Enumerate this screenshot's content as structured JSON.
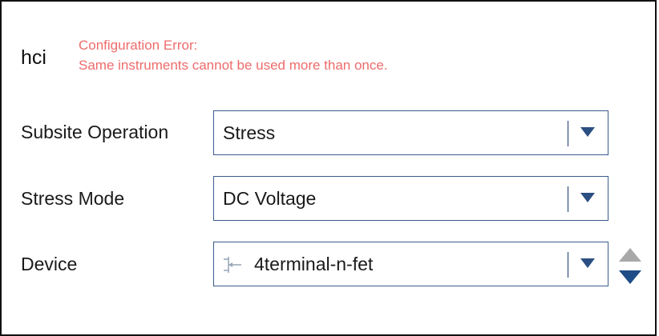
{
  "header": {
    "title": "hci",
    "error_line1": "Configuration Error:",
    "error_line2": "Same instruments cannot be used more than once."
  },
  "fields": {
    "subsite_operation": {
      "label": "Subsite Operation",
      "value": "Stress"
    },
    "stress_mode": {
      "label": "Stress Mode",
      "value": "DC Voltage"
    },
    "device": {
      "label": "Device",
      "value": "4terminal-n-fet"
    }
  },
  "colors": {
    "error": "#ee6b6b",
    "dropdown_arrow": "#2b4f82",
    "stepper_up": "#a8a8a8",
    "stepper_down": "#1f4c86"
  },
  "icons": {
    "dropdown": "caret-down-icon",
    "device": "transistor-icon",
    "stepper_up": "triangle-up-icon",
    "stepper_down": "triangle-down-icon"
  }
}
